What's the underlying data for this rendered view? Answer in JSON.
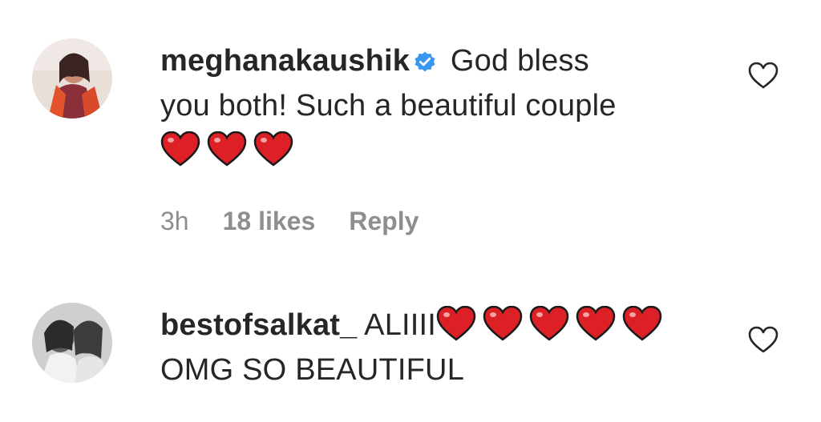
{
  "comments": [
    {
      "username": "meghanakaushik",
      "verified": true,
      "text_line1": "God bless",
      "text_line2": "you both! Such a beautiful couple",
      "emoji_icon": "red-heart-emoji",
      "emoji_count": 3,
      "time": "3h",
      "likes": "18 likes",
      "reply_label": "Reply"
    },
    {
      "username": "bestofsalkat_",
      "verified": false,
      "text_line1": "ALIIII",
      "emoji_icon": "red-heart-emoji",
      "emoji_count": 5,
      "text_line2": "OMG SO BEAUTIFUL"
    }
  ],
  "colors": {
    "text": "#262626",
    "meta": "#8e8e8e",
    "verified_blue": "#3897f0",
    "heart_red": "#dd1f26"
  }
}
